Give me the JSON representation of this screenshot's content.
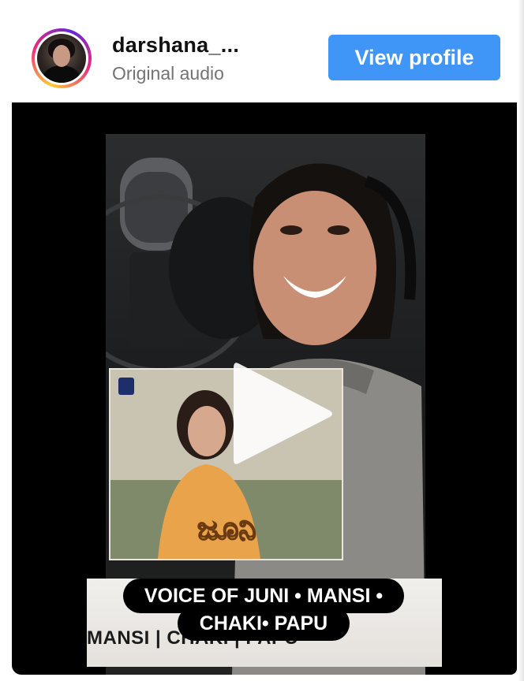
{
  "header": {
    "username": "darshana_...",
    "subtitle": "Original audio",
    "view_profile_label": "View profile"
  },
  "video": {
    "thumbnail_title": "ಜೂನಿ",
    "strip_text": "MANSI | CHAKI | PAPU",
    "caption_lines": [
      "VOICE OF JUNI • MANSI •",
      "CHAKI• PAPU"
    ]
  },
  "colors": {
    "button": "#4096f7",
    "username": "#111111",
    "subtitle": "#737373",
    "video_background": "#000000"
  },
  "icons": {
    "play": "play-icon",
    "avatar": "avatar"
  }
}
